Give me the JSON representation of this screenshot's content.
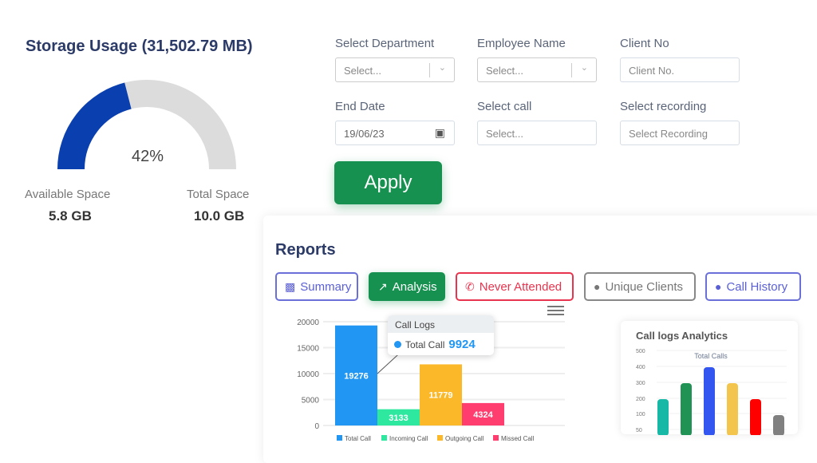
{
  "storage": {
    "title": "Storage Usage (31,502.79 MB)",
    "percent_label": "42%",
    "percent": 42,
    "available_label": "Available Space",
    "available_value": "5.8 GB",
    "total_label": "Total Space",
    "total_value": "10.0 GB"
  },
  "filters": {
    "department": {
      "label": "Select Department",
      "placeholder": "Select..."
    },
    "employee": {
      "label": "Employee Name",
      "placeholder": "Select..."
    },
    "client": {
      "label": "Client No",
      "placeholder": "Client No."
    },
    "end_date": {
      "label": "End Date",
      "value": "19/06/23"
    },
    "call": {
      "label": "Select call",
      "placeholder": "Select..."
    },
    "recording": {
      "label": "Select recording",
      "placeholder": "Select Recording"
    },
    "apply_label": "Apply"
  },
  "reports": {
    "title": "Reports",
    "tabs": [
      {
        "label": "Summary",
        "icon": "bar-chart-icon",
        "color": "#5a5fd6"
      },
      {
        "label": "Analysis",
        "icon": "trend-up-icon",
        "color": "#16914f"
      },
      {
        "label": "Never Attended",
        "icon": "phone-missed-icon",
        "color": "#e8344e"
      },
      {
        "label": "Unique Clients",
        "icon": "user-icon",
        "color": "#777"
      },
      {
        "label": "Call History",
        "icon": "user-icon",
        "color": "#5a5fd6"
      }
    ]
  },
  "tooltip": {
    "title": "Call Logs",
    "series": "Total Call",
    "value": "9924"
  },
  "chart_data": [
    {
      "type": "bar",
      "categories": [
        "Total Call",
        "Incoming Call",
        "Outgoing Call",
        "Missed Call"
      ],
      "values": [
        19276,
        3133,
        11779,
        4324
      ],
      "value_labels": [
        "19276",
        "3133",
        "11779",
        "4324"
      ],
      "colors": [
        "#2196f3",
        "#2ee8a0",
        "#fbb829",
        "#ff3d6e"
      ],
      "yticks": [
        "20000",
        "15000",
        "10000",
        "5000",
        "0"
      ],
      "ylim": [
        0,
        20000
      ],
      "grid": true,
      "legend": "bottom"
    },
    {
      "type": "bar",
      "title": "Call logs Analytics",
      "subtitle": "Total Calls",
      "values": [
        200,
        300,
        400,
        300,
        200,
        100
      ],
      "colors": [
        "#17b8a6",
        "#1f9254",
        "#3355f0",
        "#f3c54c",
        "#ff0000",
        "#808080"
      ],
      "yticks": [
        "500",
        "400",
        "300",
        "200",
        "100",
        "50"
      ],
      "ylim": [
        0,
        500
      ],
      "grid": true
    }
  ]
}
